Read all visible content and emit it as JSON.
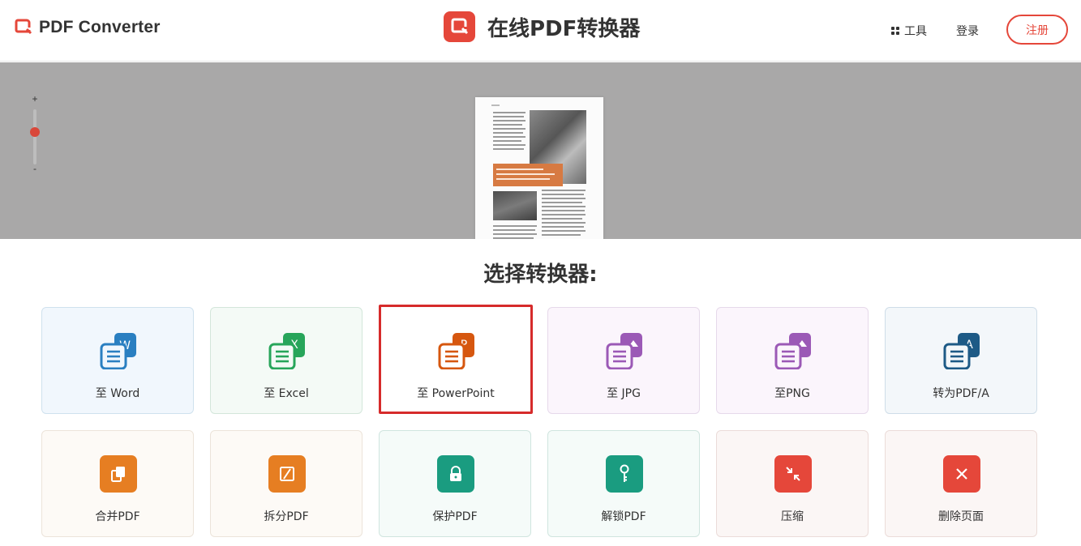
{
  "header": {
    "brand_name": "PDF Converter",
    "center_title": "在线PDF转换器",
    "tools_label": "工具",
    "login_label": "登录",
    "register_label": "注册",
    "accent_color": "#e5473a"
  },
  "preview": {
    "zoom_plus": "+",
    "zoom_minus": "-"
  },
  "section": {
    "title": "选择转换器:"
  },
  "tools": [
    {
      "label": "至 Word",
      "icon": "word-icon",
      "color": "#2a7fc1"
    },
    {
      "label": "至 Excel",
      "icon": "excel-icon",
      "color": "#27a55a"
    },
    {
      "label": "至 PowerPoint",
      "icon": "powerpoint-icon",
      "color": "#d6570f"
    },
    {
      "label": "至 JPG",
      "icon": "jpg-icon",
      "color": "#9b59b6"
    },
    {
      "label": "至PNG",
      "icon": "png-icon",
      "color": "#9b59b6"
    },
    {
      "label": "转为PDF/A",
      "icon": "pdfa-icon",
      "color": "#1d5a86"
    },
    {
      "label": "合并PDF",
      "icon": "merge-icon",
      "color": "#e67e22"
    },
    {
      "label": "拆分PDF",
      "icon": "split-icon",
      "color": "#e67e22"
    },
    {
      "label": "保护PDF",
      "icon": "lock-icon",
      "color": "#1a9c80"
    },
    {
      "label": "解锁PDF",
      "icon": "key-icon",
      "color": "#1a9c80"
    },
    {
      "label": "压缩",
      "icon": "compress-icon",
      "color": "#e5473a"
    },
    {
      "label": "删除页面",
      "icon": "delete-icon",
      "color": "#e5473a"
    }
  ]
}
